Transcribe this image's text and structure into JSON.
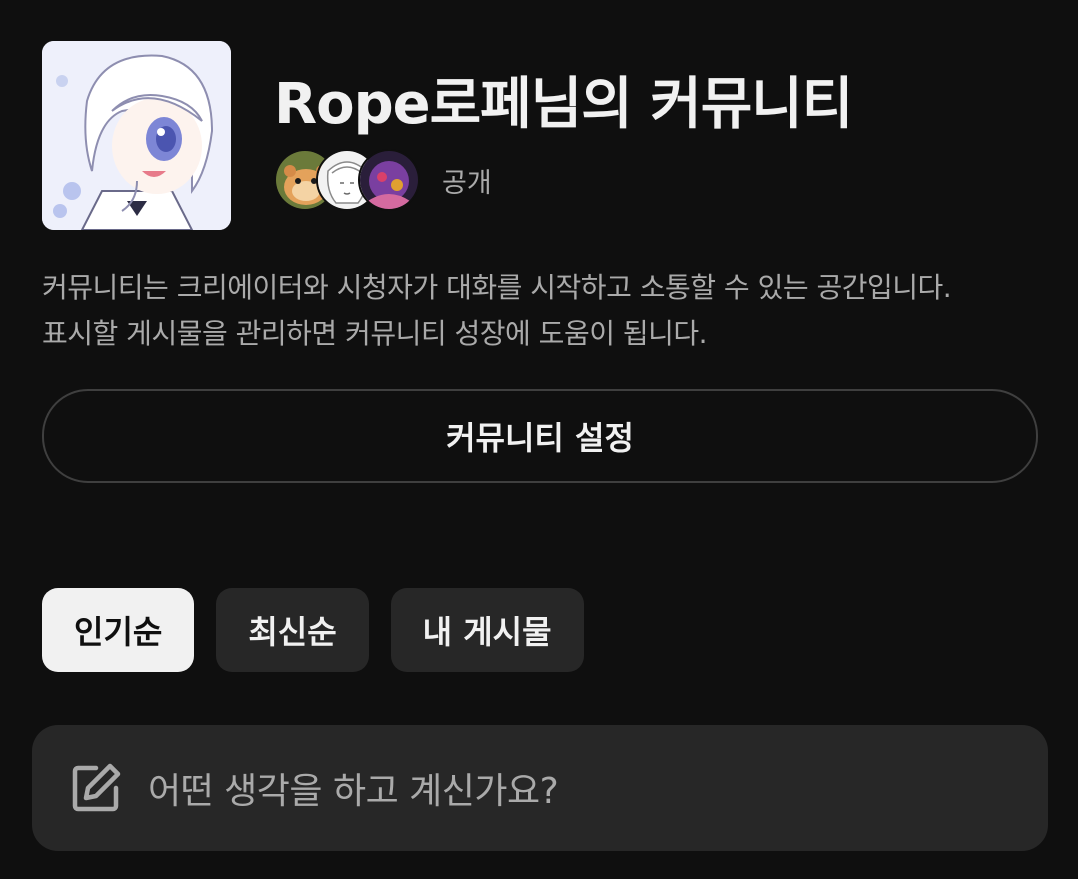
{
  "community": {
    "avatar_icon": "anime-character-avatar",
    "title": "Rope로페님의 커뮤니티",
    "members": [
      {
        "icon": "hamster-photo-avatar"
      },
      {
        "icon": "sketch-portrait-avatar"
      },
      {
        "icon": "purple-illustration-avatar"
      }
    ],
    "visibility": "공개"
  },
  "description": {
    "line1": "커뮤니티는 크리에이터와 시청자가 대화를 시작하고 소통할 수 있는 공간입니다.",
    "line2": "표시할 게시물을 관리하면 커뮤니티 성장에 도움이 됩니다."
  },
  "settings_button": {
    "label": "커뮤니티 설정"
  },
  "sort_chips": [
    {
      "label": "인기순",
      "active": true
    },
    {
      "label": "최신순",
      "active": false
    },
    {
      "label": "내 게시물",
      "active": false
    }
  ],
  "composer": {
    "icon": "edit-icon",
    "placeholder": "어떤 생각을 하고 계신가요?"
  },
  "colors": {
    "background": "#0f0f0f",
    "surface": "#272727",
    "text_primary": "#f1f1f1",
    "text_secondary": "#aaaaaa",
    "border": "#3f3f3f"
  }
}
